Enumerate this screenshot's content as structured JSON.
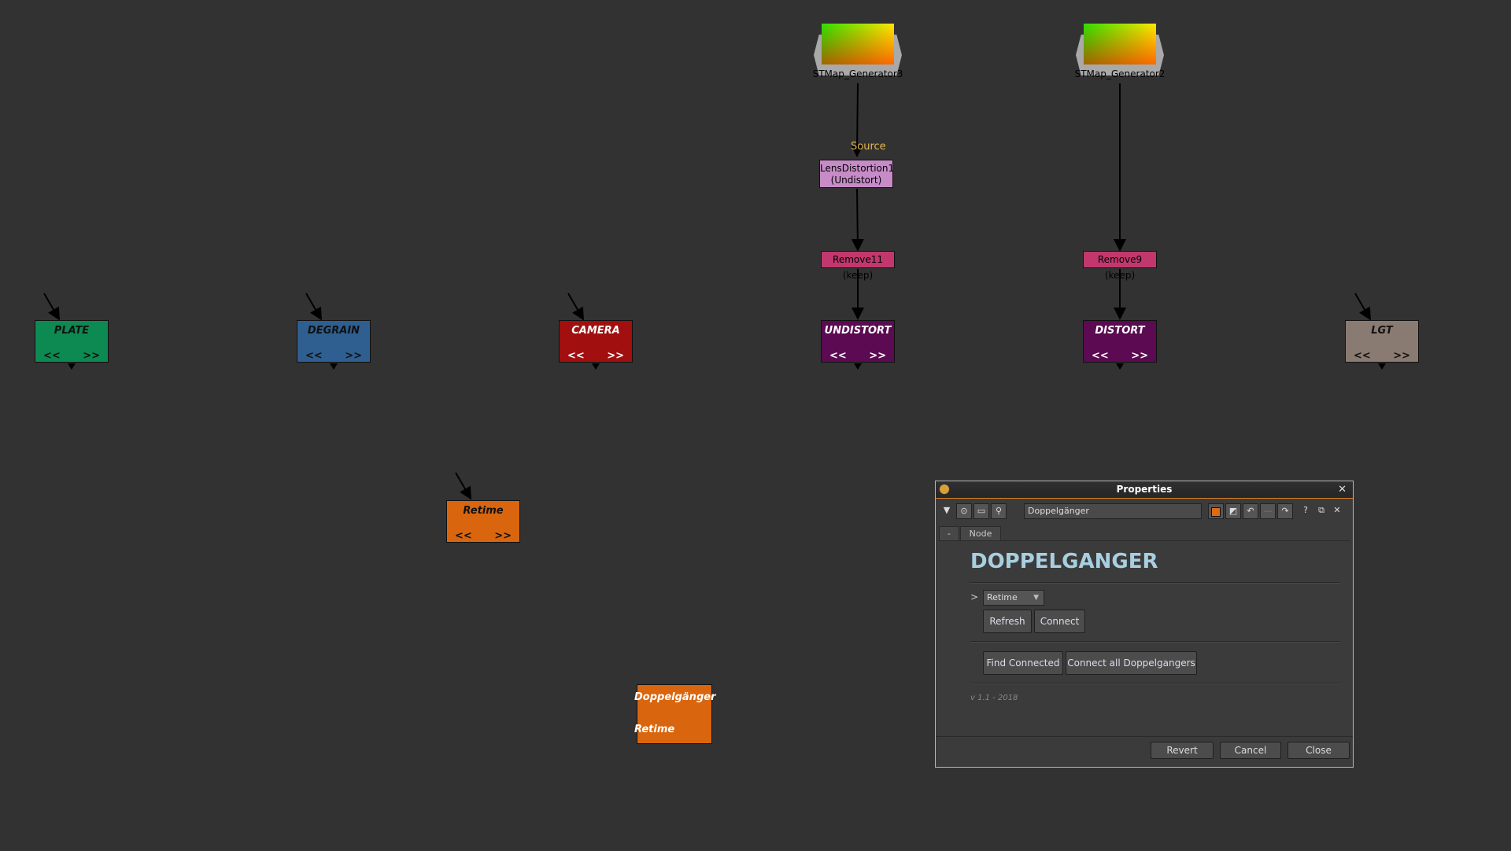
{
  "stmaps": [
    {
      "label": "STMap_Generator3"
    },
    {
      "label": "STMap_Generator2"
    }
  ],
  "source_label": "Source",
  "lens_node": {
    "line1": "LensDistortion1",
    "line2": "(Undistort)"
  },
  "remove_nodes": [
    {
      "label": "Remove11 (keep)"
    },
    {
      "label": "Remove9 (keep)"
    }
  ],
  "nav": {
    "prev": "<<",
    "next": ">>"
  },
  "backdrops": [
    {
      "title": "PLATE",
      "color": "#0c8a52"
    },
    {
      "title": "DEGRAIN",
      "color": "#2e5f90"
    },
    {
      "title": "CAMERA",
      "color": "#a20f0f"
    },
    {
      "title": "UNDISTORT",
      "color": "#5c0a52"
    },
    {
      "title": "DISTORT",
      "color": "#5c0a52"
    },
    {
      "title": "LGT",
      "color": "#8a7b72"
    },
    {
      "title": "Retime",
      "color": "#d9660e"
    }
  ],
  "doppel_node": {
    "title": "Doppelgänger",
    "subtitle": "Retime",
    "color": "#d9660e"
  },
  "properties": {
    "window_title": "Properties",
    "node_name": "Doppelgänger",
    "tab_collapse": "-",
    "tab_node": "Node",
    "heading": "DOPPELGANGER",
    "chevron": ">",
    "dropdown_value": "Retime",
    "refresh_label": "Refresh",
    "connect_label": "Connect",
    "find_connected_label": "Find Connected",
    "connect_all_label": "Connect all Doppelgangers",
    "version": "v 1.1 - 2018",
    "revert_label": "Revert",
    "cancel_label": "Cancel",
    "close_label": "Close"
  }
}
